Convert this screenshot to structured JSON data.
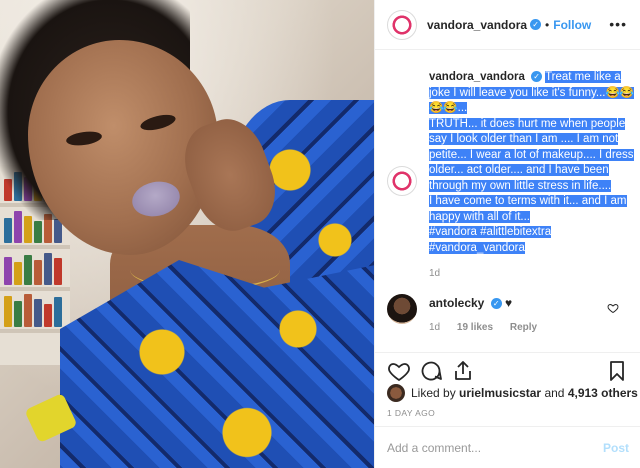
{
  "post": {
    "username": "vandora_vandora",
    "separator": "•",
    "follow_label": "Follow",
    "more_label": "•••",
    "verified_glyph": "✓"
  },
  "caption": {
    "username": "vandora_vandora",
    "line1": "Treat me like a joke I will leave you like it's funny...😂😂😂😂...",
    "line2": "TRUTH... it does hurt me when people say I look older than I am .... I am not petite... I wear a lot of makeup.... I dress older... act older.... and I have been through my own little stress in life....",
    "line3": "I have come to terms with it... and I am happy with all of it...",
    "tags1": "#vandora #alittlebitextra",
    "tags2": "#vandora_vandora",
    "time": "1d"
  },
  "reply": {
    "username": "antolecky",
    "text": "♥",
    "time": "1d",
    "likes": "19 likes",
    "reply_label": "Reply"
  },
  "likes": {
    "prefix": "Liked by",
    "user": "urielmusicstar",
    "and": "and",
    "count": "4,913 others"
  },
  "ago": "1 DAY AGO",
  "comment_box": {
    "placeholder": "Add a comment...",
    "post_label": "Post"
  },
  "colors": {
    "selection": "#3e82f7",
    "link_blue": "#3897f0",
    "post_disabled": "#b2dffc"
  }
}
